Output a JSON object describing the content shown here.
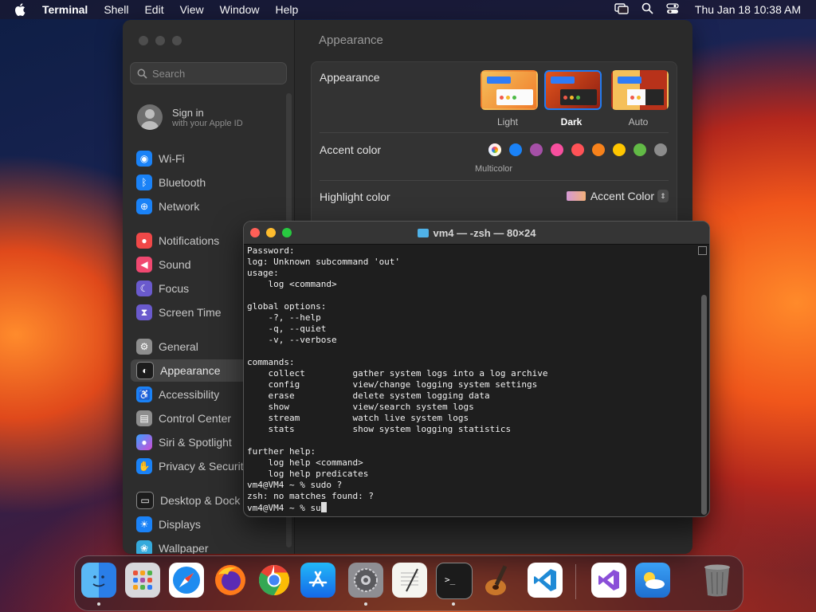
{
  "menubar": {
    "app_name": "Terminal",
    "menus": [
      "Shell",
      "Edit",
      "View",
      "Window",
      "Help"
    ],
    "clock": "Thu Jan 18  10:38 AM",
    "status_icons": [
      "screen-mirroring-icon",
      "spotlight-search-icon",
      "control-center-icon"
    ]
  },
  "settings": {
    "search_placeholder": "Search",
    "signin_title": "Sign in",
    "signin_subtitle": "with your Apple ID",
    "sidebar_items": [
      {
        "label": "Wi-Fi",
        "icon": "wifi-icon",
        "color": "#1a82f7"
      },
      {
        "label": "Bluetooth",
        "icon": "bluetooth-icon",
        "color": "#1a82f7"
      },
      {
        "label": "Network",
        "icon": "globe-icon",
        "color": "#1a82f7"
      },
      {
        "label": "Notifications",
        "icon": "bell-icon",
        "color": "#f04848"
      },
      {
        "label": "Sound",
        "icon": "speaker-icon",
        "color": "#f04870"
      },
      {
        "label": "Focus",
        "icon": "moon-icon",
        "color": "#6a5acd"
      },
      {
        "label": "Screen Time",
        "icon": "hourglass-icon",
        "color": "#6a5acd"
      },
      {
        "label": "General",
        "icon": "gear-icon",
        "color": "#8e8e8e"
      },
      {
        "label": "Appearance",
        "icon": "appearance-icon",
        "color": "#1c1c1c"
      },
      {
        "label": "Accessibility",
        "icon": "accessibility-icon",
        "color": "#1a82f7"
      },
      {
        "label": "Control Center",
        "icon": "control-center-icon",
        "color": "#8e8e8e"
      },
      {
        "label": "Siri & Spotlight",
        "icon": "siri-icon",
        "color": "#b84fe0"
      },
      {
        "label": "Privacy & Security",
        "icon": "hand-icon",
        "color": "#1a82f7"
      },
      {
        "label": "Desktop & Dock",
        "icon": "dock-icon",
        "color": "#1c1c1c"
      },
      {
        "label": "Displays",
        "icon": "sun-icon",
        "color": "#1a82f7"
      },
      {
        "label": "Wallpaper",
        "icon": "wallpaper-icon",
        "color": "#35aadc"
      }
    ],
    "page_title": "Appearance",
    "appearance_label": "Appearance",
    "themes": [
      "Light",
      "Dark",
      "Auto"
    ],
    "selected_theme": "Dark",
    "accent_label": "Accent color",
    "accent_colors": [
      "multicolor",
      "#1a82f7",
      "#a550a7",
      "#f74f9e",
      "#ff5257",
      "#f7821b",
      "#ffc600",
      "#62ba46",
      "#8c8c8c"
    ],
    "accent_selected_caption": "Multicolor",
    "highlight_label": "Highlight color",
    "highlight_value": "Accent Color"
  },
  "terminal": {
    "title": "vm4 — -zsh — 80×24",
    "lines": [
      "Password:",
      "log: Unknown subcommand 'out'",
      "usage:",
      "    log <command>",
      "",
      "global options:",
      "    -?, --help",
      "    -q, --quiet",
      "    -v, --verbose",
      "",
      "commands:",
      "    collect         gather system logs into a log archive",
      "    config          view/change logging system settings",
      "    erase           delete system logging data",
      "    show            view/search system logs",
      "    stream          watch live system logs",
      "    stats           show system logging statistics",
      "",
      "further help:",
      "    log help <command>",
      "    log help predicates",
      "vm4@VM4 ~ % sudo ?",
      "zsh: no matches found: ?"
    ],
    "prompt_line": "vm4@VM4 ~ % su"
  },
  "dock": {
    "apps": [
      {
        "name": "Finder",
        "icon": "finder-icon",
        "running": true
      },
      {
        "name": "Launchpad",
        "icon": "launchpad-icon",
        "running": false
      },
      {
        "name": "Safari",
        "icon": "safari-icon",
        "running": false
      },
      {
        "name": "Firefox",
        "icon": "firefox-icon",
        "running": false
      },
      {
        "name": "Chrome",
        "icon": "chrome-icon",
        "running": false
      },
      {
        "name": "App Store",
        "icon": "app-store-icon",
        "running": false
      },
      {
        "name": "System Settings",
        "icon": "system-settings-icon",
        "running": true
      },
      {
        "name": "TextEdit",
        "icon": "textedit-icon",
        "running": false
      },
      {
        "name": "Terminal",
        "icon": "terminal-icon",
        "running": true
      },
      {
        "name": "GarageBand",
        "icon": "garageband-icon",
        "running": false
      },
      {
        "name": "Visual Studio Code",
        "icon": "vscode-icon",
        "running": false
      },
      {
        "name": "Visual Studio",
        "icon": "visual-studio-icon",
        "running": false
      },
      {
        "name": "Weather",
        "icon": "weather-icon",
        "running": false
      },
      {
        "name": "Trash",
        "icon": "trash-icon",
        "running": false
      }
    ]
  }
}
